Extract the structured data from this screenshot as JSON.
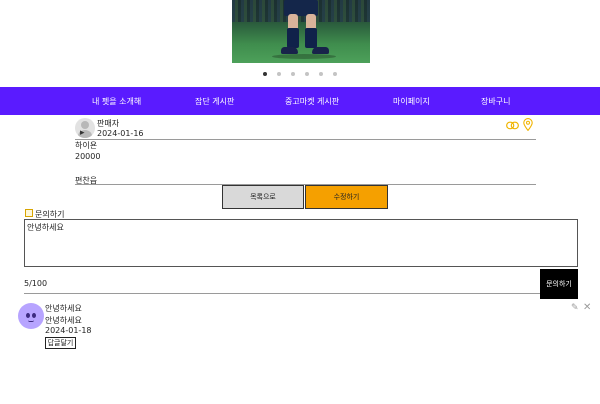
{
  "carousel": {
    "slide_count": 6,
    "active_index": 0
  },
  "nav": {
    "items": [
      {
        "label": "내 펫을 소개해"
      },
      {
        "label": "잡단 게시판"
      },
      {
        "label": "중고마켓 게시판"
      },
      {
        "label": "마이페이지"
      },
      {
        "label": "장바구니"
      }
    ],
    "bg_color": "#5a1bff"
  },
  "post": {
    "seller": "판매자",
    "date": "2024-01-16",
    "title": "하이욘",
    "price": "20000",
    "location": "편찬읍",
    "icons": [
      "link-icon",
      "location-pin-icon"
    ],
    "buttons": {
      "list": "목록으로",
      "edit": "수정하기"
    },
    "accent_color": "#f5a000"
  },
  "inquiry": {
    "title": "문의하기",
    "value": "안녕하세요",
    "count": "5/100",
    "submit": "문의하기"
  },
  "comment": {
    "author": "안녕하세요",
    "text": "안녕하세요",
    "date": "2024-01-18",
    "reply": "답글달기"
  }
}
